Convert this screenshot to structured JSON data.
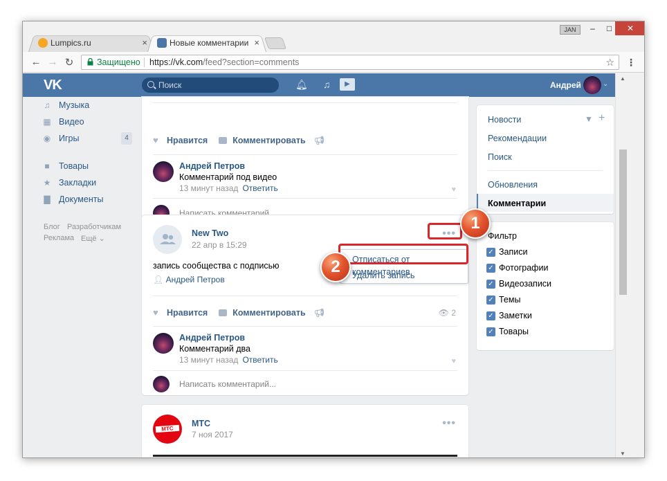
{
  "browser": {
    "tabs": [
      {
        "label": "Lumpics.ru",
        "close": "×"
      },
      {
        "label": "Новые комментарии",
        "close": "×"
      }
    ],
    "user_badge": "JAN",
    "win_min": "–",
    "win_max": "□",
    "win_close": "✕",
    "secure_label": "Защищено",
    "url_host": "https://vk.com",
    "url_path": "/feed?section=comments",
    "colors": {
      "close": "#c7443b",
      "secure": "#0b8043"
    }
  },
  "vk": {
    "logo": "VK",
    "search_placeholder": "Поиск",
    "user_name": "Андрей",
    "colors": {
      "header": "#4a76a8",
      "link": "#2a5885"
    }
  },
  "leftnav": {
    "items": [
      {
        "label": "Музыка",
        "icon": "music-icon"
      },
      {
        "label": "Видео",
        "icon": "video-icon"
      },
      {
        "label": "Игры",
        "icon": "games-icon",
        "badge": "4"
      },
      {
        "label": "Товары",
        "icon": "goods-icon"
      },
      {
        "label": "Закладки",
        "icon": "bookmarks-icon"
      },
      {
        "label": "Документы",
        "icon": "documents-icon"
      }
    ],
    "footer": {
      "blog": "Блог",
      "dev": "Разработчикам",
      "ads": "Реклама",
      "more": "Ещё"
    }
  },
  "feed": {
    "like_label": "Нравится",
    "comment_label": "Комментировать",
    "write_placeholder": "Написать комментарий...",
    "reply_label": "Ответить",
    "card1": {
      "comment": {
        "author": "Андрей Петров",
        "text": "Комментарий под видео",
        "time": "13 минут назад"
      }
    },
    "card2": {
      "author": "New Two",
      "date": "22 апр в 15:29",
      "text": "запись сообщества с подписью",
      "signed_by": "Андрей Петров",
      "views": "2",
      "comment": {
        "author": "Андрей Петров",
        "text": "Комментарий два",
        "time": "13 минут назад"
      }
    },
    "card3": {
      "author": "МТС",
      "date": "7 ноя 2017",
      "logo_text": "МТС"
    },
    "context_menu": {
      "unsubscribe": "Отписаться от комментариев",
      "delete": "Удалить запись"
    }
  },
  "callouts": {
    "first": "1",
    "second": "2"
  },
  "rightnav": {
    "items": [
      "Новости",
      "Рекомендации",
      "Поиск"
    ],
    "items2": [
      "Обновления",
      "Комментарии"
    ],
    "filter_title": "Фильтр",
    "filters": [
      "Записи",
      "Фотографии",
      "Видеозаписи",
      "Темы",
      "Заметки",
      "Товары"
    ]
  }
}
